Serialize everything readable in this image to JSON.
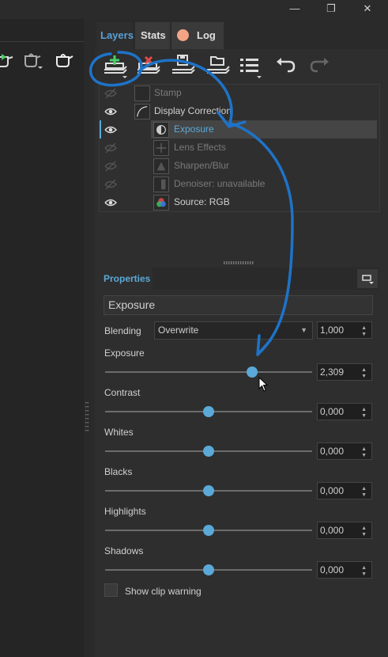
{
  "window": {
    "minimize_icon": "minimize-icon",
    "maximize_icon": "restore-icon",
    "close_icon": "close-icon",
    "minimize_glyph": "—",
    "restore_glyph": "❐",
    "close_glyph": "✕"
  },
  "tabs": [
    {
      "label": "Layers",
      "active": true
    },
    {
      "label": "Stats",
      "active": false
    },
    {
      "label": "Log",
      "active": false
    }
  ],
  "layers": [
    {
      "name": "Stamp",
      "visible": false,
      "dim": true
    },
    {
      "name": "Display Correction",
      "visible": true,
      "dim": false
    },
    {
      "name": "Exposure",
      "visible": true,
      "dim": false,
      "selected": true
    },
    {
      "name": "Lens Effects",
      "visible": false,
      "dim": true
    },
    {
      "name": "Sharpen/Blur",
      "visible": false,
      "dim": true
    },
    {
      "name": "Denoiser: unavailable",
      "visible": false,
      "dim": true
    },
    {
      "name": "Source: RGB",
      "visible": true,
      "dim": false
    }
  ],
  "properties": {
    "title": "Properties",
    "layer_name": "Exposure",
    "blending_label": "Blending",
    "blending_value": "Overwrite",
    "blending_opacity": "1,000",
    "sliders": [
      {
        "label": "Exposure",
        "value": "2,309",
        "position": 0.71
      },
      {
        "label": "Contrast",
        "value": "0,000",
        "position": 0.5
      },
      {
        "label": "Whites",
        "value": "0,000",
        "position": 0.5
      },
      {
        "label": "Blacks",
        "value": "0,000",
        "position": 0.5
      },
      {
        "label": "Highlights",
        "value": "0,000",
        "position": 0.5
      },
      {
        "label": "Shadows",
        "value": "0,000",
        "position": 0.5
      }
    ],
    "clip_warning_label": "Show clip warning",
    "clip_warning_checked": false
  },
  "colors": {
    "accent": "#5aa9d8",
    "annotation": "#1e73c8",
    "selected_row": "#454545"
  }
}
